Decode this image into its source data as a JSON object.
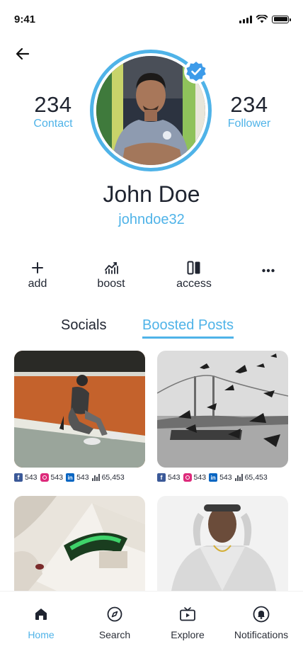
{
  "status_bar": {
    "time": "9:41"
  },
  "profile": {
    "name": "John Doe",
    "handle": "johndoe32",
    "contact_count": "234",
    "contact_label": "Contact",
    "follower_count": "234",
    "follower_label": "Follower"
  },
  "actions": [
    {
      "label": "add",
      "icon": "plus-icon"
    },
    {
      "label": "boost",
      "icon": "chart-icon"
    },
    {
      "label": "access",
      "icon": "columns-icon"
    },
    {
      "label": "",
      "icon": "more-icon"
    }
  ],
  "tabs": [
    {
      "label": "Socials",
      "active": false
    },
    {
      "label": "Boosted Posts",
      "active": true
    }
  ],
  "posts": [
    {
      "facebook": "543",
      "instagram": "543",
      "linkedin": "543",
      "views": "65,453"
    },
    {
      "facebook": "543",
      "instagram": "543",
      "linkedin": "543",
      "views": "65,453"
    }
  ],
  "bottom_nav": [
    {
      "label": "Home",
      "icon": "home-icon",
      "active": true
    },
    {
      "label": "Search",
      "icon": "compass-icon",
      "active": false
    },
    {
      "label": "Explore",
      "icon": "play-screen-icon",
      "active": false
    },
    {
      "label": "Notifications",
      "icon": "bell-icon",
      "active": false
    }
  ],
  "colors": {
    "accent": "#4fb3e8",
    "text": "#1f2430",
    "facebook": "#3b5998",
    "instagram": "#dd2a7b",
    "linkedin": "#0a66c2"
  }
}
